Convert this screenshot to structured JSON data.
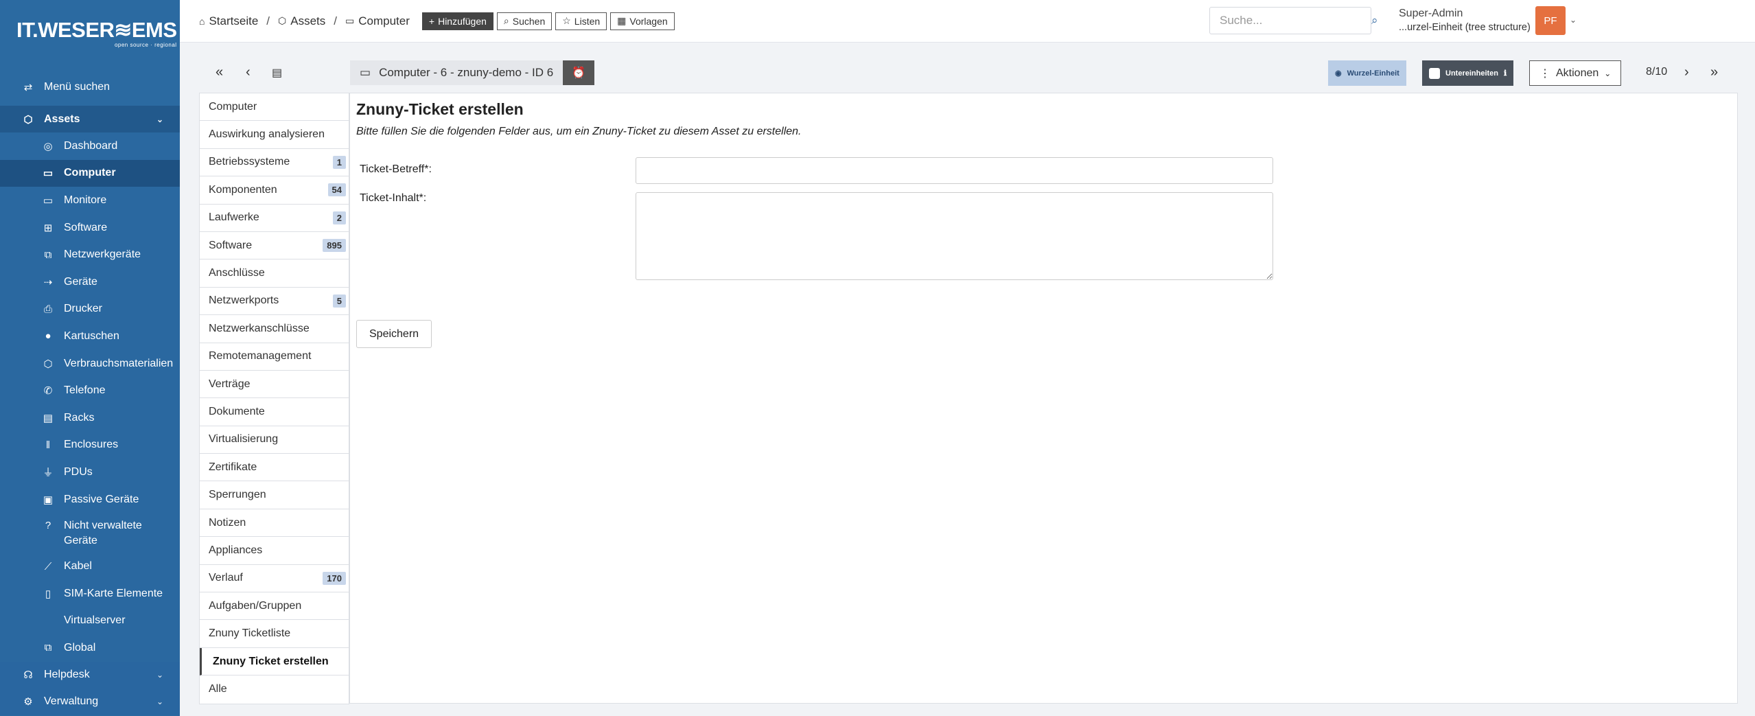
{
  "brand": {
    "logo": "IT.WESER≋EMS",
    "tagline": "open source · regional"
  },
  "sidebar": {
    "menu_search": "Menü suchen",
    "assets_label": "Assets",
    "items": [
      {
        "label": "Dashboard",
        "icon": "dashboard-icon"
      },
      {
        "label": "Computer",
        "icon": "laptop-icon"
      },
      {
        "label": "Monitore",
        "icon": "monitor-icon"
      },
      {
        "label": "Software",
        "icon": "apps-icon"
      },
      {
        "label": "Netzwerkgeräte",
        "icon": "network-icon"
      },
      {
        "label": "Geräte",
        "icon": "usb-icon"
      },
      {
        "label": "Drucker",
        "icon": "printer-icon"
      },
      {
        "label": "Kartuschen",
        "icon": "droplet-icon"
      },
      {
        "label": "Verbrauchsmaterialien",
        "icon": "package-icon"
      },
      {
        "label": "Telefone",
        "icon": "phone-icon"
      },
      {
        "label": "Racks",
        "icon": "server-icon"
      },
      {
        "label": "Enclosures",
        "icon": "columns-icon"
      },
      {
        "label": "PDUs",
        "icon": "plug-icon"
      },
      {
        "label": "Passive Geräte",
        "icon": "box-icon"
      },
      {
        "label": "Nicht verwaltete Geräte",
        "icon": "question-icon"
      },
      {
        "label": "Kabel",
        "icon": "cable-icon"
      },
      {
        "label": "SIM-Karte Elemente",
        "icon": "sim-card-icon"
      },
      {
        "label": "Virtualserver",
        "icon": ""
      },
      {
        "label": "Global",
        "icon": "network-icon"
      }
    ],
    "helpdesk_label": "Helpdesk",
    "admin_label": "Verwaltung"
  },
  "topbar": {
    "breadcrumb": [
      "Startseite",
      "Assets",
      "Computer"
    ],
    "add_label": "Hinzufügen",
    "search_label": "Suchen",
    "lists_label": "Listen",
    "templates_label": "Vorlagen",
    "search_placeholder": "Suche...",
    "user_name": "Super-Admin",
    "user_entity": "...urzel-Einheit (tree structure)",
    "avatar_initials": "PF"
  },
  "objectbar": {
    "title": "Computer - 6 - znuny-demo - ID 6",
    "entity_badge": "Wurzel-Einheit",
    "subentities_label": "Untereinheiten",
    "actions_label": "Aktionen",
    "pager": "8/10"
  },
  "tabs": [
    {
      "label": "Computer",
      "count": ""
    },
    {
      "label": "Auswirkung analysieren",
      "count": ""
    },
    {
      "label": "Betriebssysteme",
      "count": "1"
    },
    {
      "label": "Komponenten",
      "count": "54"
    },
    {
      "label": "Laufwerke",
      "count": "2"
    },
    {
      "label": "Software",
      "count": "895"
    },
    {
      "label": "Anschlüsse",
      "count": ""
    },
    {
      "label": "Netzwerkports",
      "count": "5"
    },
    {
      "label": "Netzwerkanschlüsse",
      "count": ""
    },
    {
      "label": "Remotemanagement",
      "count": ""
    },
    {
      "label": "Verträge",
      "count": ""
    },
    {
      "label": "Dokumente",
      "count": ""
    },
    {
      "label": "Virtualisierung",
      "count": ""
    },
    {
      "label": "Zertifikate",
      "count": ""
    },
    {
      "label": "Sperrungen",
      "count": ""
    },
    {
      "label": "Notizen",
      "count": ""
    },
    {
      "label": "Appliances",
      "count": ""
    },
    {
      "label": "Verlauf",
      "count": "170"
    },
    {
      "label": "Aufgaben/Gruppen",
      "count": ""
    },
    {
      "label": "Znuny Ticketliste",
      "count": ""
    },
    {
      "label": "Znuny Ticket erstellen",
      "count": "",
      "active": true
    },
    {
      "label": "Alle",
      "count": ""
    }
  ],
  "form": {
    "title": "Znuny-Ticket erstellen",
    "description": "Bitte füllen Sie die folgenden Felder aus, um ein Znuny-Ticket zu diesem Asset zu erstellen.",
    "subject_label": "Ticket-Betreff*:",
    "subject_value": "",
    "body_label": "Ticket-Inhalt*:",
    "body_value": "",
    "save_label": "Speichern"
  }
}
